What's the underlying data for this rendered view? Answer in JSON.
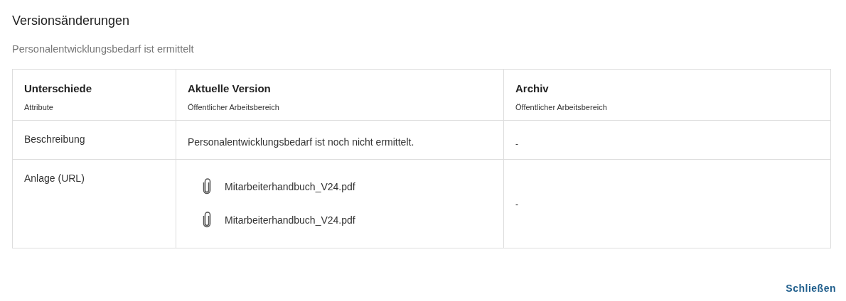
{
  "dialog": {
    "title": "Versionsänderungen",
    "subtitle": "Personalentwicklungsbedarf ist ermittelt"
  },
  "table": {
    "columns": [
      {
        "title": "Unterschiede",
        "subtitle": "Attribute"
      },
      {
        "title": "Aktuelle Version",
        "subtitle": "Öffentlicher Arbeitsbereich"
      },
      {
        "title": "Archiv",
        "subtitle": "Öffentlicher Arbeitsbereich"
      }
    ],
    "rows": [
      {
        "attribute": "Beschreibung",
        "current": {
          "kind": "text",
          "text": "Personalentwicklungsbedarf ist noch nicht ermittelt."
        },
        "archive": "-"
      },
      {
        "attribute": "Anlage (URL)",
        "current": {
          "kind": "attachments",
          "files": [
            "Mitarbeiterhandbuch_V24.pdf",
            "Mitarbeiterhandbuch_V24.pdf"
          ]
        },
        "archive": "-"
      }
    ]
  },
  "buttons": [
    "Schließen"
  ]
}
